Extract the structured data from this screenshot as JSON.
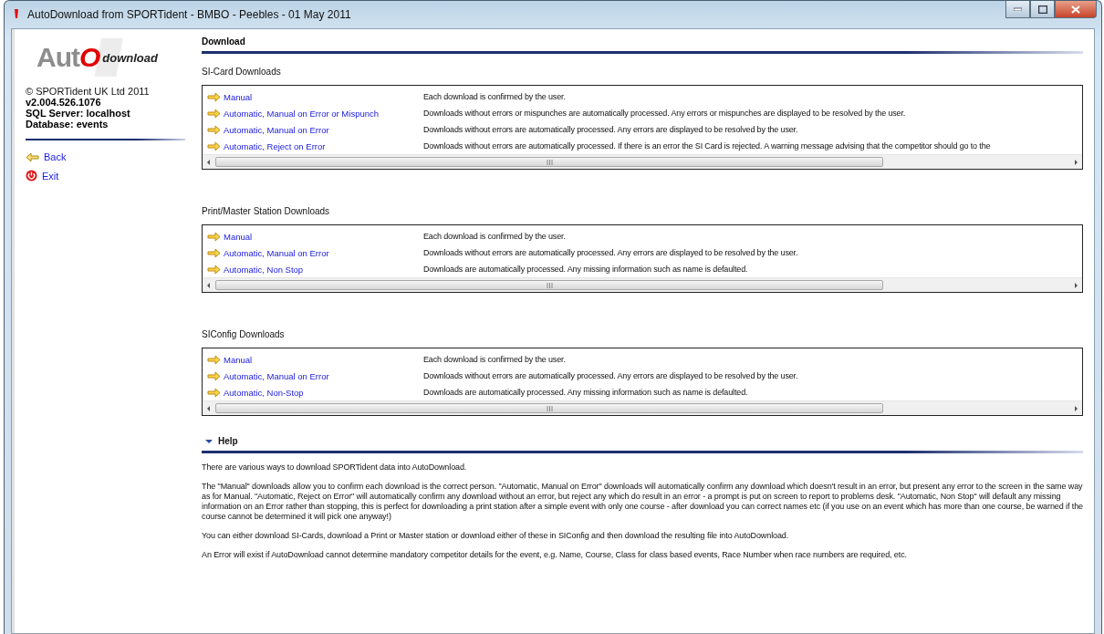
{
  "window": {
    "title": "AutoDownload from SPORTident - BMBO - Peebles - 01 May 2011"
  },
  "sidebar": {
    "logo": {
      "prefix": "Aut",
      "mark": "O",
      "suffix": "download"
    },
    "copyright": "© SPORTident UK Ltd 2011",
    "details": [
      "v2.004.526.1076",
      "SQL Server: localhost",
      "Database: events"
    ],
    "links": [
      {
        "label": "Back",
        "kind": "back"
      },
      {
        "label": "Exit",
        "kind": "exit"
      }
    ]
  },
  "content": {
    "title": "Download",
    "sections": [
      {
        "title": "SI-Card Downloads",
        "options": [
          {
            "label": "Manual",
            "description": "Each download is confirmed by the user."
          },
          {
            "label": "Automatic, Manual on Error or Mispunch",
            "description": "Downloads without errors or mispunches are automatically processed. Any errors or mispunches are displayed to be resolved by the user."
          },
          {
            "label": "Automatic, Manual on Error",
            "description": "Downloads without errors are automatically processed. Any errors are displayed to be resolved by the user."
          },
          {
            "label": "Automatic, Reject on Error",
            "description": "Downloads without errors are automatically processed. If there is an error the SI Card is rejected. A warning message advising that the competitor should go to the"
          }
        ]
      },
      {
        "title": "Print/Master Station Downloads",
        "options": [
          {
            "label": "Manual",
            "description": "Each download is confirmed by the user."
          },
          {
            "label": "Automatic, Manual on Error",
            "description": "Downloads without errors are automatically processed. Any errors are displayed to be resolved by the user."
          },
          {
            "label": "Automatic, Non Stop",
            "description": "Downloads are automatically processed. Any missing information such as name is defaulted."
          }
        ]
      },
      {
        "title": "SIConfig Downloads",
        "options": [
          {
            "label": "Manual",
            "description": "Each download is confirmed by the user."
          },
          {
            "label": "Automatic, Manual on Error",
            "description": "Downloads without errors are automatically processed. Any errors are displayed to be resolved by the user."
          },
          {
            "label": "Automatic, Non-Stop",
            "description": "Downloads are automatically processed. Any missing information such as name is defaulted."
          }
        ]
      }
    ]
  },
  "help": {
    "title": "Help",
    "expanded": true,
    "paragraphs": [
      "There are various ways to download SPORTident data into AutoDownload.",
      "The \"Manual\" downloads allow you to confirm each download is the correct person. \"Automatic, Manual on Error\" downloads will automatically confirm any download which doesn't result in an error, but present any error to the screen in the same way as for Manual. \"Automatic, Reject on Error\" will automatically confirm any download without an error, but reject any which do result in an error - a prompt is put on screen to report to problems desk. \"Automatic, Non Stop\" will default any missing information on an Error rather than stopping, this is perfect for downloading a print station after a simple event with only one course - after download you can correct names etc (if you use on an event which has more than one course, be warned if the course cannot be determined it will pick one anyway!)",
      "You can either download SI-Cards, download a Print or Master station or download either of these in SIConfig and then download the resulting file into AutoDownload.",
      "An Error will exist if AutoDownload cannot determine mandatory competitor details for the event, e.g. Name, Course, Class for class based events, Race Number when race numbers are required, etc."
    ]
  }
}
